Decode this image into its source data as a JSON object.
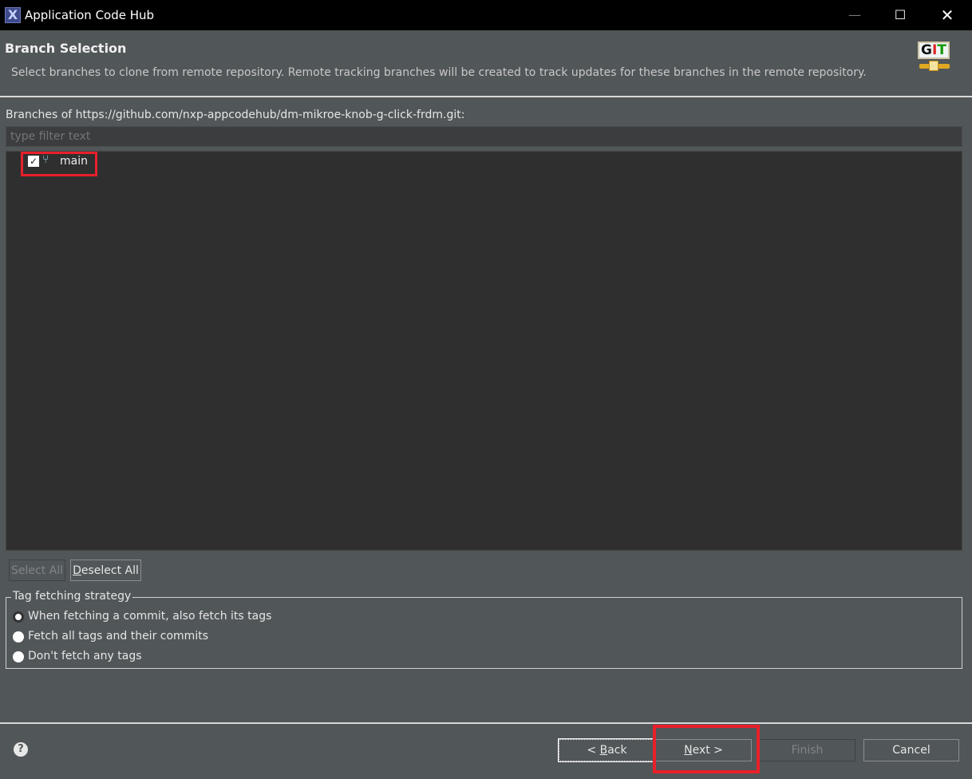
{
  "window": {
    "title": "Application Code Hub",
    "app_icon": "X"
  },
  "header": {
    "title": "Branch Selection",
    "description": "Select branches to clone from remote repository. Remote tracking branches will be created to track updates for these branches in the remote repository.",
    "logo_text": "GIT"
  },
  "branches": {
    "label": "Branches of https://github.com/nxp-appcodehub/dm-mikroe-knob-g-click-frdm.git:",
    "filter_placeholder": "type filter text",
    "items": [
      {
        "name": "main",
        "checked": true
      }
    ]
  },
  "selection_buttons": {
    "select_all": "Select All",
    "deselect_all_mnemonic": "D",
    "deselect_all_rest": "eselect All"
  },
  "tag_strategy": {
    "legend": "Tag fetching strategy",
    "options": [
      {
        "label": "When fetching a commit, also fetch its tags",
        "selected": true
      },
      {
        "label": "Fetch all tags and their commits",
        "selected": false
      },
      {
        "label": "Don't fetch any tags",
        "selected": false
      }
    ]
  },
  "footer": {
    "back_prefix": "< ",
    "back_mnemonic": "B",
    "back_rest": "ack",
    "next_mnemonic": "N",
    "next_rest": "ext >",
    "finish": "Finish",
    "cancel": "Cancel",
    "help": "?"
  }
}
